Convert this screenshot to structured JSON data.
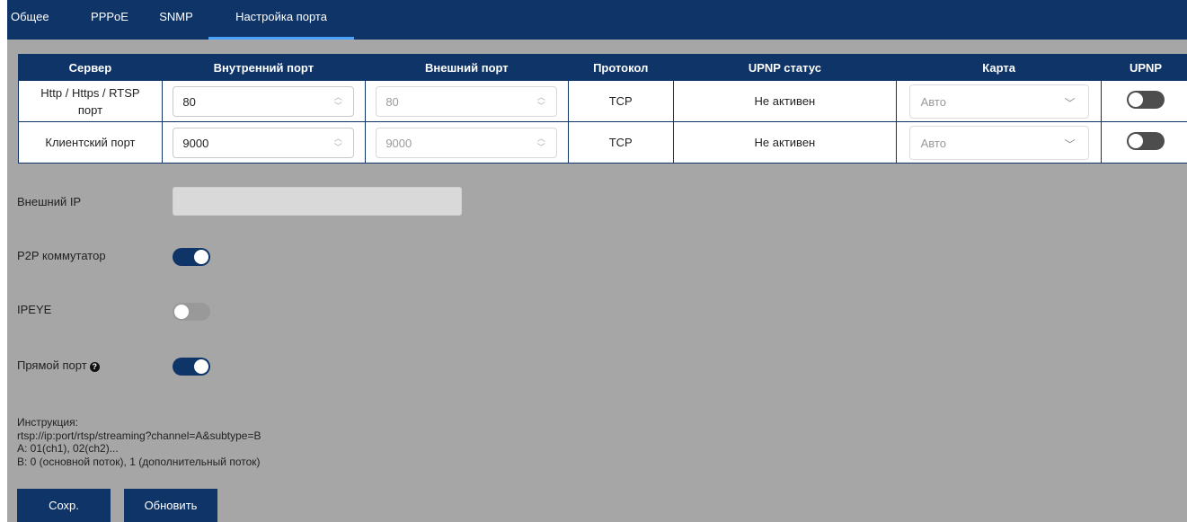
{
  "tabs": [
    {
      "label": "Общее",
      "active": false
    },
    {
      "label": "PPPoE",
      "active": false
    },
    {
      "label": "SNMP",
      "active": false
    },
    {
      "label": "Настройка порта",
      "active": true
    }
  ],
  "table": {
    "headers": [
      "Сервер",
      "Внутренний порт",
      "Внешний порт",
      "Протокол",
      "UPNP статус",
      "Карта",
      "UPNP"
    ],
    "rows": [
      {
        "server": "Http / Https / RTSP порт",
        "internal_port": "80",
        "external_port": "80",
        "protocol": "TCP",
        "upnp_status": "Не активен",
        "map": "Авто",
        "upnp_enabled": false
      },
      {
        "server": "Клиентский порт",
        "internal_port": "9000",
        "external_port": "9000",
        "protocol": "TCP",
        "upnp_status": "Не активен",
        "map": "Авто",
        "upnp_enabled": false
      }
    ]
  },
  "settings": {
    "external_ip_label": "Внешний IP",
    "external_ip_value": "",
    "p2p_label": "P2P коммутатор",
    "p2p_enabled": true,
    "ipeye_label": "IPEYE",
    "ipeye_enabled": false,
    "direct_port_label": "Прямой порт",
    "direct_port_enabled": true
  },
  "instructions": {
    "line1": "Инструкция:",
    "line2": "rtsp://ip:port/rtsp/streaming?channel=A&subtype=B",
    "line3": "A: 01(ch1), 02(ch2)...",
    "line4": "B: 0 (основной поток), 1 (дополнительный поток)"
  },
  "buttons": {
    "save_label": "Сохр.",
    "refresh_label": "Обновить"
  },
  "colors": {
    "header_bg": "#0f3568",
    "page_bg": "#a6a6a6",
    "toggle_on": "#0f3568",
    "toggle_off": "#4d4d4d"
  }
}
